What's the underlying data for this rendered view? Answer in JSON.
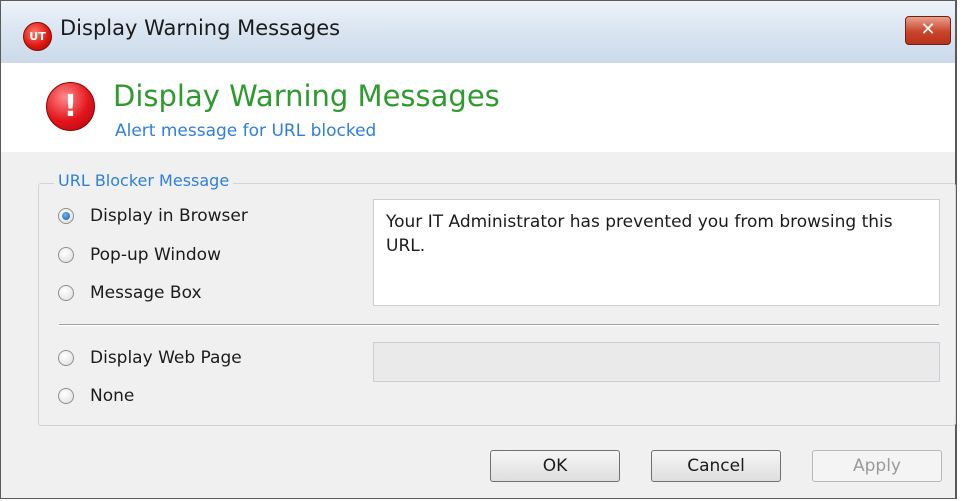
{
  "window": {
    "title": "Display Warning Messages",
    "app_icon_text": "UT",
    "close_symbol": "✕"
  },
  "header": {
    "icon_symbol": "!",
    "title": "Display Warning Messages",
    "subtitle": "Alert message for URL blocked"
  },
  "group": {
    "legend": "URL Blocker Message",
    "options": [
      {
        "label": "Display in Browser",
        "selected": true
      },
      {
        "label": "Pop-up Window",
        "selected": false
      },
      {
        "label": "Message Box",
        "selected": false
      },
      {
        "label": "Display Web Page",
        "selected": false
      },
      {
        "label": "None",
        "selected": false
      }
    ],
    "message_text": "Your IT Administrator has prevented you from browsing this URL.",
    "web_page_value": ""
  },
  "buttons": {
    "ok": "OK",
    "cancel": "Cancel",
    "apply": "Apply"
  },
  "colors": {
    "title_green": "#2f9a2f",
    "link_blue": "#2f7fd8",
    "warning_red": "#e3141b"
  },
  "icons": {
    "app": "app-logo-icon",
    "warning": "warning-icon",
    "close": "close-icon"
  }
}
